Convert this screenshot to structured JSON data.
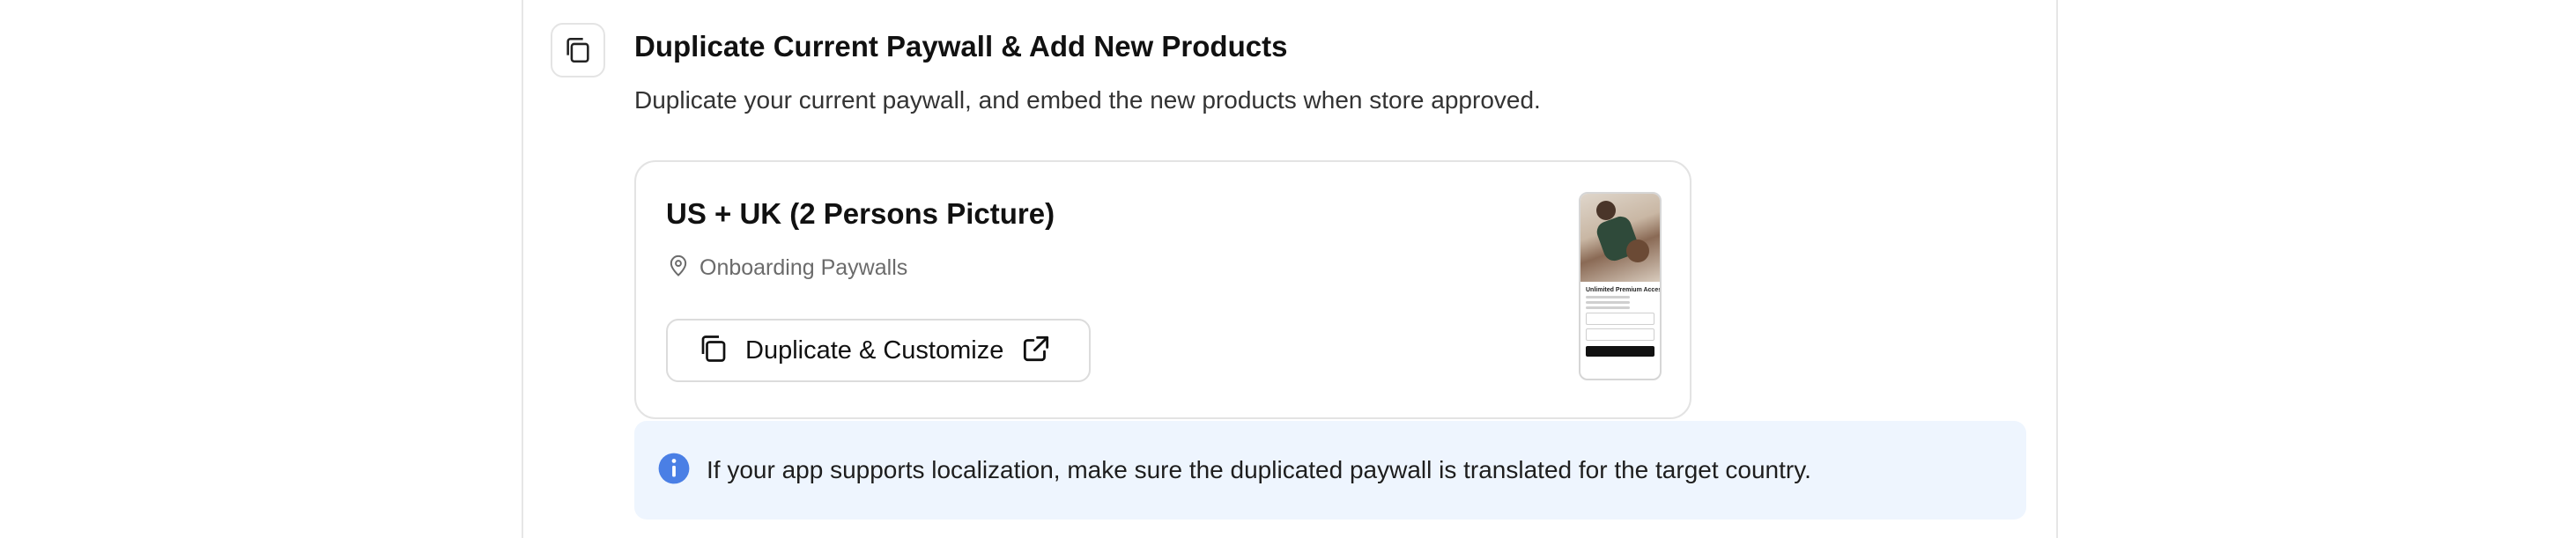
{
  "step": {
    "icon": "copy-icon",
    "title": "Duplicate Current Paywall & Add New Products",
    "description": "Duplicate your current paywall, and embed the new products when store approved."
  },
  "paywall_card": {
    "title": "US + UK (2 Persons Picture)",
    "placement_icon": "location-pin-icon",
    "placement": "Onboarding Paywalls",
    "button": {
      "label": "Duplicate & Customize",
      "leading_icon": "copy-icon",
      "trailing_icon": "external-link-icon"
    },
    "thumbnail": {
      "heading": "Unlimited Premium Access"
    }
  },
  "info": {
    "icon": "info-icon",
    "text": "If your app supports localization, make sure the duplicated paywall is translated for the target country.",
    "accent_color": "#4a7fe5",
    "background_color": "#eef5fe"
  }
}
